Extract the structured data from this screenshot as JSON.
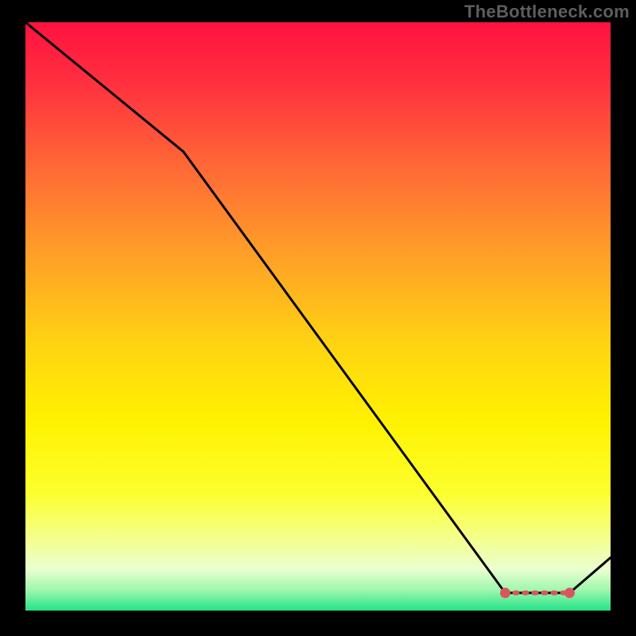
{
  "watermark": "TheBottleneck.com",
  "colors": {
    "black": "#000000",
    "curve": "#000000",
    "marker_fill": "#d9565e",
    "marker_stroke": "#d9565e"
  },
  "chart_data": {
    "type": "line",
    "title": "",
    "xlabel": "",
    "ylabel": "",
    "xlim": [
      0,
      100
    ],
    "ylim": [
      0,
      100
    ],
    "note": "No axes, ticks, or legend are visible; x is horizontal position (0=left edge of colored area, 100=right), y is vertical position (0=bottom, 100=top). Values estimated from pixels.",
    "series": [
      {
        "name": "curve",
        "x": [
          0.0,
          27.0,
          82.0,
          93.0,
          100.0
        ],
        "y": [
          100.0,
          78.0,
          3.0,
          3.0,
          9.0
        ]
      }
    ],
    "markers": [
      {
        "name": "valley-start-marker",
        "x": 82.0,
        "y": 3.0,
        "shape": "circle"
      },
      {
        "name": "valley-end-marker",
        "x": 93.0,
        "y": 3.0,
        "shape": "circle"
      }
    ],
    "dashed_segment": {
      "from": {
        "x": 82.0,
        "y": 3.0
      },
      "to": {
        "x": 93.0,
        "y": 3.0
      }
    },
    "background_gradient": {
      "direction": "vertical",
      "stops": [
        {
          "pos": 0.0,
          "color": "#ff1240"
        },
        {
          "pos": 0.1,
          "color": "#ff2f3f"
        },
        {
          "pos": 0.25,
          "color": "#ff6a36"
        },
        {
          "pos": 0.4,
          "color": "#ffa127"
        },
        {
          "pos": 0.55,
          "color": "#ffd412"
        },
        {
          "pos": 0.68,
          "color": "#fff200"
        },
        {
          "pos": 0.8,
          "color": "#fcff2e"
        },
        {
          "pos": 0.88,
          "color": "#f4ff90"
        },
        {
          "pos": 0.93,
          "color": "#eaffd0"
        },
        {
          "pos": 0.965,
          "color": "#9ef7ad"
        },
        {
          "pos": 1.0,
          "color": "#25e38a"
        }
      ]
    }
  }
}
